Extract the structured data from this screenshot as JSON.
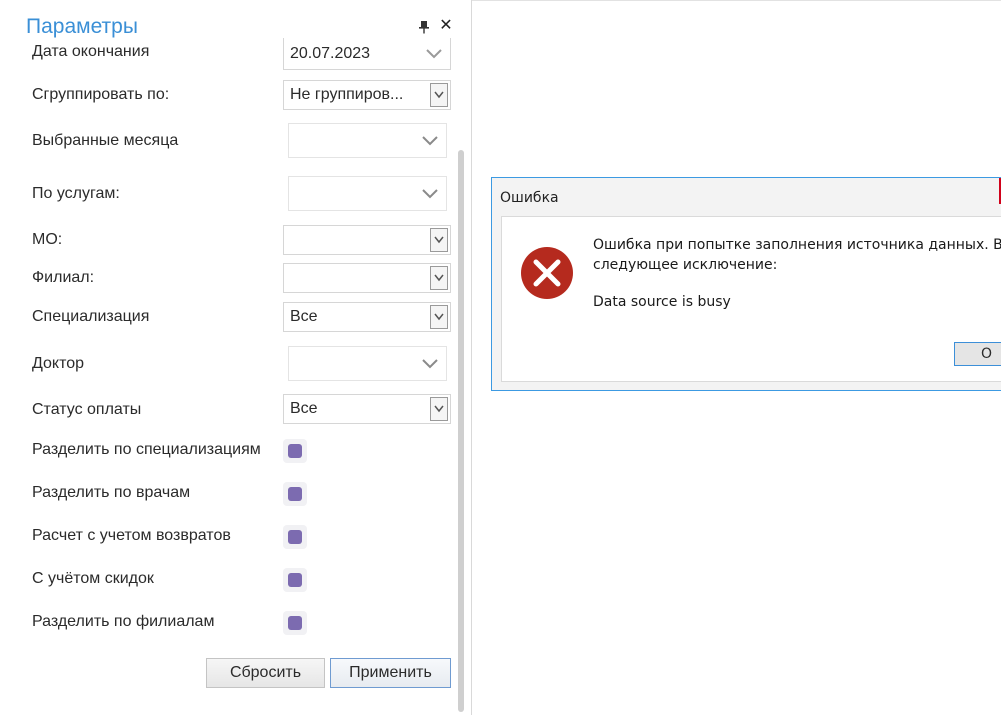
{
  "panel": {
    "title": "Параметры",
    "pin_icon": "pin-icon",
    "close_icon": "close-icon",
    "close_glyph": "✕"
  },
  "fields": {
    "end_date": {
      "label": "Дата окончания",
      "value": "20.07.2023"
    },
    "group_by": {
      "label": "Сгруппировать по:",
      "value": "Не группиров..."
    },
    "selected_months": {
      "label": "Выбранные месяца",
      "value": ""
    },
    "by_services": {
      "label": "По услугам:",
      "value": ""
    },
    "mo": {
      "label": "МО:",
      "value": ""
    },
    "branch": {
      "label": "Филиал:",
      "value": ""
    },
    "specialization": {
      "label": "Специализация",
      "value": "Все"
    },
    "doctor": {
      "label": "Доктор",
      "value": ""
    },
    "payment_status": {
      "label": "Статус оплаты",
      "value": "Все"
    }
  },
  "checkboxes": {
    "split_by_specialization": {
      "label": "Разделить по специализациям",
      "checked": true
    },
    "split_by_doctors": {
      "label": "Разделить по врачам",
      "checked": true
    },
    "with_returns": {
      "label": "Расчет с учетом возвратов",
      "checked": true
    },
    "with_discounts": {
      "label": "С учётом скидок",
      "checked": true
    },
    "split_by_branches": {
      "label": "Разделить по филиалам",
      "checked": true
    }
  },
  "buttons": {
    "reset": "Сбросить",
    "apply": "Применить"
  },
  "dialog": {
    "title": "Ошибка",
    "message_line1": "Ошибка при попытке заполнения источника данных. Возн",
    "message_line2": "следующее исключение:",
    "detail": "Data source is busy",
    "ok_label": "O",
    "icon": "error-icon"
  },
  "colors": {
    "title_accent": "#3a8fd6",
    "checkbox_fill": "#7c6bb0",
    "error_red": "#b52a1e",
    "dialog_border": "#3c9ae2"
  }
}
